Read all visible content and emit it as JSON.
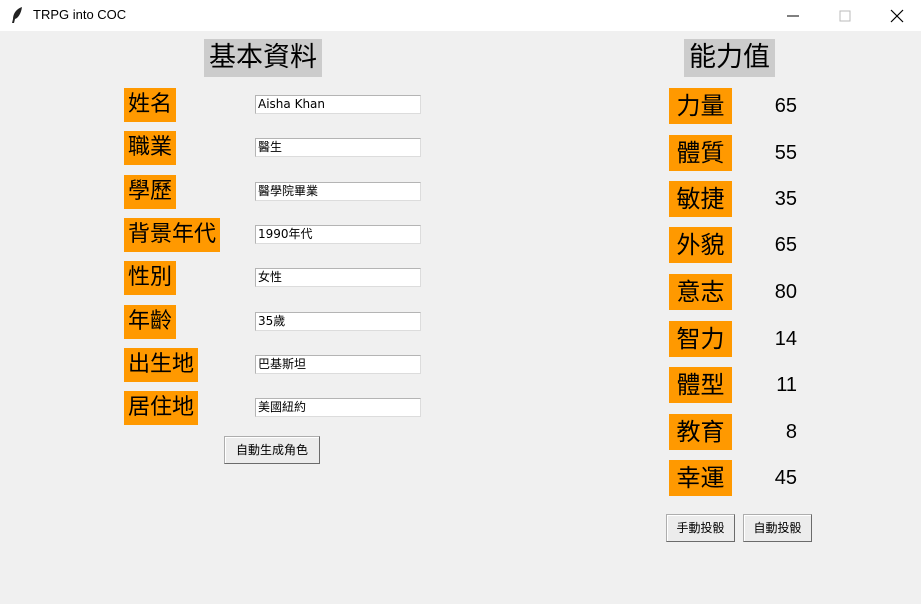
{
  "window": {
    "title": "TRPG into COC"
  },
  "basic": {
    "heading": "基本資料",
    "fields": [
      {
        "label": "姓名",
        "value": "Aisha Khan"
      },
      {
        "label": "職業",
        "value": "醫生"
      },
      {
        "label": "學歷",
        "value": "醫學院畢業"
      },
      {
        "label": "背景年代",
        "value": "1990年代"
      },
      {
        "label": "性別",
        "value": "女性"
      },
      {
        "label": "年齡",
        "value": "35歲"
      },
      {
        "label": "出生地",
        "value": "巴基斯坦"
      },
      {
        "label": "居住地",
        "value": "美國紐約"
      }
    ],
    "auto_generate_button": "自動生成角色"
  },
  "ability": {
    "heading": "能力值",
    "stats": [
      {
        "label": "力量",
        "value": "65"
      },
      {
        "label": "體質",
        "value": "55"
      },
      {
        "label": "敏捷",
        "value": "35"
      },
      {
        "label": "外貌",
        "value": "65"
      },
      {
        "label": "意志",
        "value": "80"
      },
      {
        "label": "智力",
        "value": "14"
      },
      {
        "label": "體型",
        "value": "11"
      },
      {
        "label": "教育",
        "value": "8"
      },
      {
        "label": "幸運",
        "value": "45"
      }
    ],
    "manual_roll_button": "手動投骰",
    "auto_roll_button": "自動投骰"
  },
  "colors": {
    "label_bg": "#ff9900",
    "heading_bg": "#cccccc",
    "window_bg": "#f0f0f0"
  },
  "icons": [
    "feather-icon",
    "minimize-icon",
    "maximize-icon",
    "close-icon"
  ]
}
